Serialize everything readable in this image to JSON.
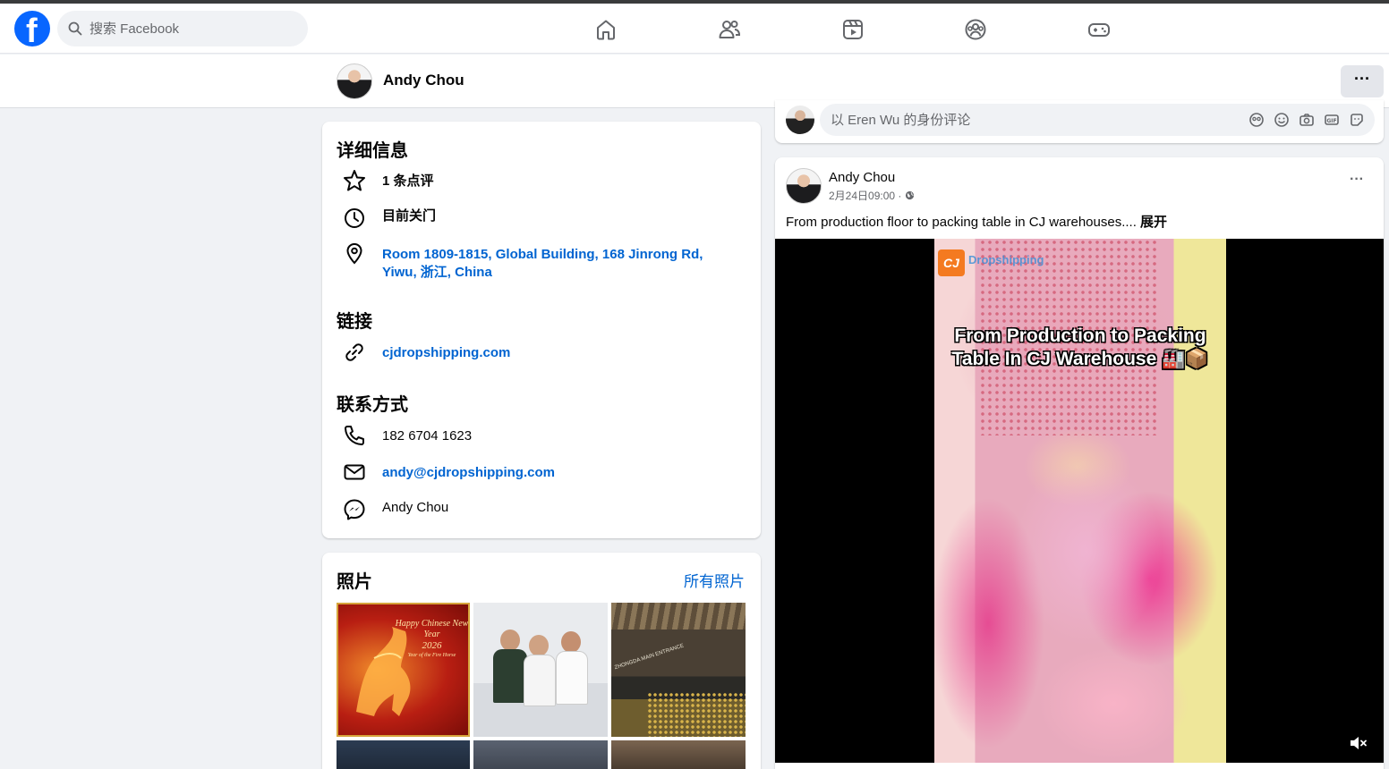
{
  "topbar": {
    "logo": "f",
    "search_placeholder": "搜索 Facebook",
    "nav_icons": [
      "home-icon",
      "friends-icon",
      "video-icon",
      "groups-icon",
      "gaming-icon"
    ]
  },
  "profile_bar": {
    "name": "Andy Chou",
    "more": "···"
  },
  "details": {
    "title": "详细信息",
    "reviews": "1 条点评",
    "hours": "目前关门",
    "address": "Room 1809-1815, Global Building, 168 Jinrong Rd, Yiwu, 浙江, China",
    "links_title": "链接",
    "website": "cjdropshipping.com",
    "contact_title": "联系方式",
    "phone": "182 6704 1623",
    "email": "andy@cjdropshipping.com",
    "messenger": "Andy Chou"
  },
  "photos": {
    "title": "照片",
    "see_all": "所有照片",
    "thumb1": {
      "greeting": "Happy Chinese New Year",
      "year": "2026",
      "subtitle": "Year of the Fire Horse"
    },
    "thumb3_sign": "ZHONGDA MAIN ENTRANCE"
  },
  "comment_box": {
    "placeholder": "以 Eren Wu 的身份评论"
  },
  "post": {
    "author": "Andy Chou",
    "time": "2月24日09:00 · ",
    "text": "From production floor to packing table in CJ warehouses.... ",
    "see_more": "展开",
    "more": "···",
    "video": {
      "brand": "Dropshipping",
      "caption": "From Production to Packing Table In CJ Warehouse 🏭📦"
    }
  },
  "colors": {
    "brand_blue": "#0866ff",
    "link_blue": "#0064d1",
    "background": "#f0f2f5"
  }
}
